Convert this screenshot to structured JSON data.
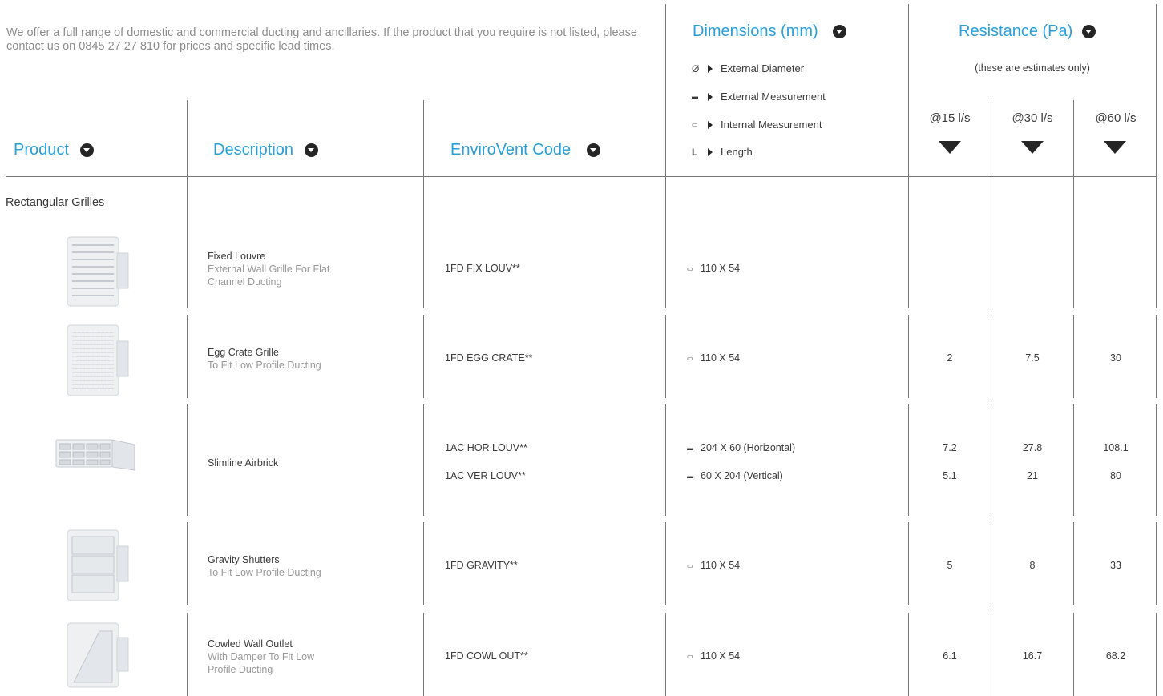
{
  "intro": "We offer a full range of domestic and commercial ducting and ancillaries. If the product that you require is not listed, please contact us on 0845 27 27 810 for prices and specific lead times.",
  "headers": {
    "product": "Product",
    "description": "Description",
    "code": "EnviroVent Code",
    "dimensions": "Dimensions (mm)",
    "resistance": "Resistance (Pa)"
  },
  "dimension_key": [
    {
      "symbol": "Ø",
      "label": "External Diameter"
    },
    {
      "symbol": "▬",
      "label": "External Measurement"
    },
    {
      "symbol": "▭",
      "label": "Internal Measurement"
    },
    {
      "symbol": "L",
      "label": "Length"
    }
  ],
  "resistance_note": "(these are estimates only)",
  "rates": [
    "@15 l/s",
    "@30 l/s",
    "@60 l/s"
  ],
  "section": "Rectangular Grilles",
  "products": [
    {
      "title": "Fixed Louvre",
      "subtitle": "External Wall Grille For Flat Channel Ducting",
      "codes": [
        "1FD FIX LOUV**"
      ],
      "dims": [
        "110 X 54"
      ],
      "values": [
        [
          "",
          "",
          ""
        ]
      ]
    },
    {
      "title": "Egg Crate Grille",
      "subtitle": "To Fit Low Profile Ducting",
      "codes": [
        "1FD EGG CRATE**"
      ],
      "dims": [
        "110 X 54"
      ],
      "values": [
        [
          "2",
          "7.5",
          "30"
        ]
      ]
    },
    {
      "title": "Slimline Airbrick",
      "subtitle": "",
      "codes": [
        "1AC HOR LOUV**",
        "1AC VER LOUV**"
      ],
      "dims": [
        "204 X 60 (Horizontal)",
        "60 X 204 (Vertical)"
      ],
      "values": [
        [
          "7.2",
          "27.8",
          "108.1"
        ],
        [
          "5.1",
          "21",
          "80"
        ]
      ]
    },
    {
      "title": "Gravity Shutters",
      "subtitle": "To Fit Low Profile Ducting",
      "codes": [
        "1FD GRAVITY**"
      ],
      "dims": [
        "110 X 54"
      ],
      "values": [
        [
          "5",
          "8",
          "33"
        ]
      ]
    },
    {
      "title": "Cowled Wall Outlet",
      "subtitle": "With Damper To Fit Low Profile Ducting",
      "codes": [
        "1FD COWL OUT**"
      ],
      "dims": [
        "110 X 54"
      ],
      "values": [
        [
          "6.1",
          "16.7",
          "68.2"
        ]
      ]
    }
  ]
}
